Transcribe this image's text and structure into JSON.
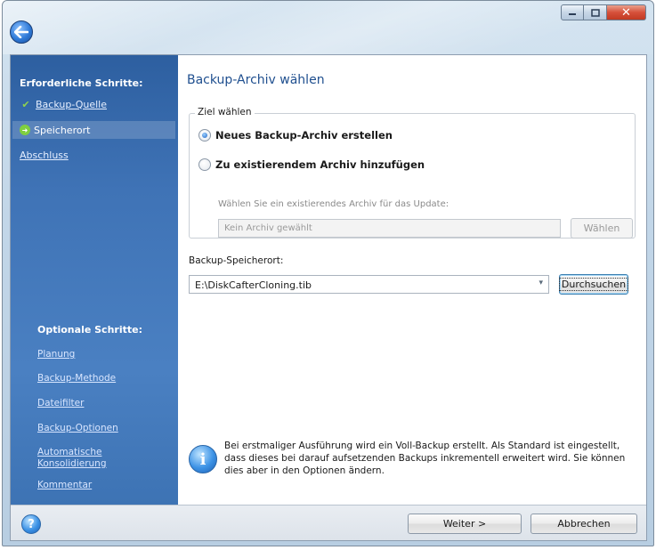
{
  "window": {
    "caption_min_icon": "minimize-icon",
    "caption_max_icon": "maximize-icon",
    "caption_close_glyph": "✕",
    "back_icon": "back-arrow-icon"
  },
  "sidebar": {
    "required_heading": "Erforderliche Schritte:",
    "required_items": [
      {
        "label": "Backup-Quelle",
        "state": "done",
        "mark": "✔"
      },
      {
        "label": "Speicherort",
        "state": "current",
        "mark": "➜"
      },
      {
        "label": "Abschluss",
        "state": "pending"
      }
    ],
    "optional_heading": "Optionale Schritte:",
    "optional_items": [
      {
        "label": "Planung"
      },
      {
        "label": "Backup-Methode"
      },
      {
        "label": "Dateifilter"
      },
      {
        "label": "Backup-Optionen"
      },
      {
        "label": "Automatische Konsolidierung"
      },
      {
        "label": "Kommentar"
      }
    ]
  },
  "main": {
    "title": "Backup-Archiv wählen",
    "target_group": {
      "legend": "Ziel wählen",
      "option_new": "Neues Backup-Archiv erstellen",
      "option_new_selected": true,
      "option_existing": "Zu existierendem Archiv hinzufügen",
      "hint": "Wählen Sie ein existierendes Archiv für das Update:",
      "archive_value": "Kein Archiv gewählt",
      "choose_button": "Wählen",
      "choose_enabled": false
    },
    "location": {
      "label": "Backup-Speicherort:",
      "value": "E:\\DiskCafterCloning.tib",
      "dropdown_glyph": "▾",
      "browse_button": "Durchsuchen"
    },
    "info": {
      "icon": "info-icon",
      "icon_glyph": "i",
      "text": "Bei erstmaliger Ausführung wird ein Voll-Backup erstellt. Als Standard ist eingestellt, dass dieses bei darauf aufsetzenden Backups inkrementell erweitert wird. Sie können dies aber in den Optionen ändern."
    }
  },
  "footer": {
    "help_icon": "help-icon",
    "help_glyph": "?",
    "next_button": "Weiter >",
    "cancel_button": "Abbrechen"
  },
  "colors": {
    "sidebar_top": "#2d5fa0",
    "sidebar_bottom": "#4a80c2",
    "title_color": "#1f4f8f",
    "close_button": "#d6503a"
  }
}
